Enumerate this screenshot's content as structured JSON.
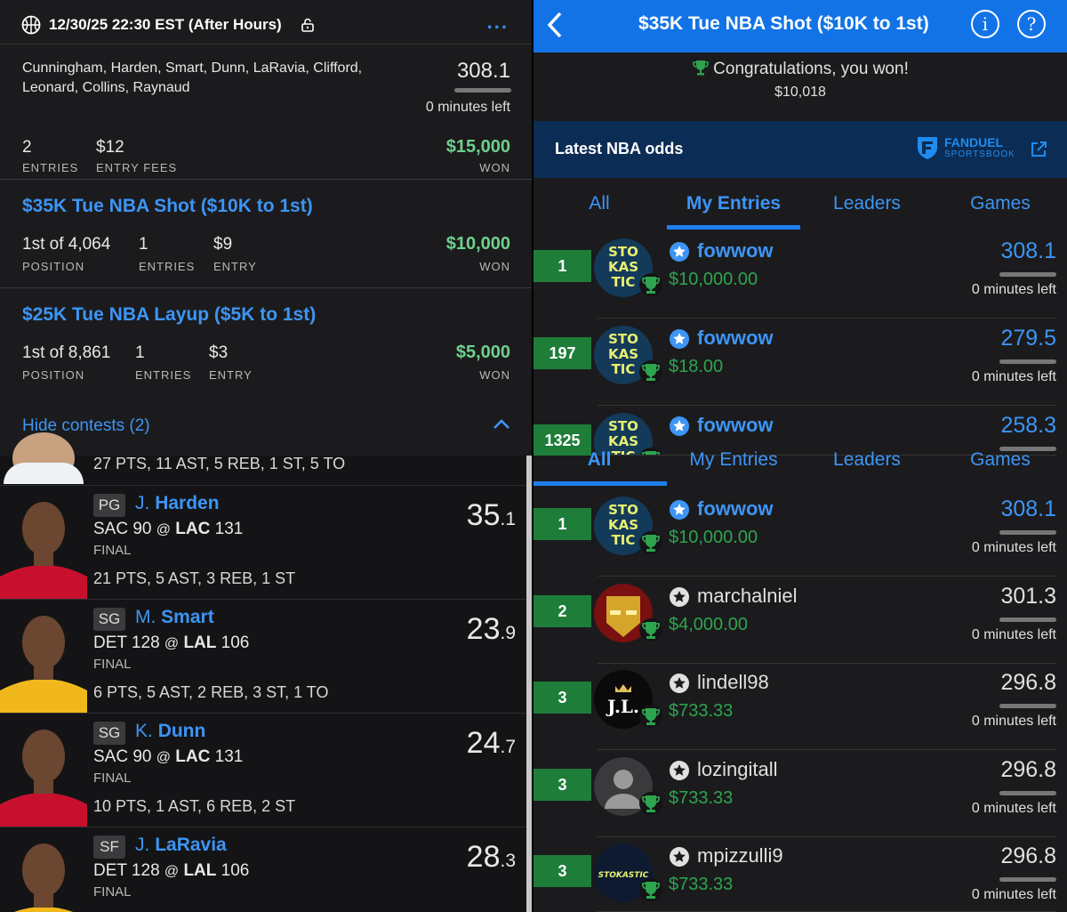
{
  "left": {
    "header": {
      "timestamp": "12/30/25 22:30 EST (After Hours)",
      "more": "..."
    },
    "lineup": {
      "players": "Cunningham, Harden, Smart, Dunn, LaRavia, Clifford, Leonard, Collins, Raynaud",
      "score": "308.1",
      "minutes_left": "0 minutes left",
      "entries_value": "2",
      "entries_label": "ENTRIES",
      "fees_value": "$12",
      "fees_label": "ENTRY FEES",
      "won_value": "$15,000",
      "won_label": "WON"
    },
    "contests": [
      {
        "title": "$35K Tue NBA Shot ($10K to 1st)",
        "position": "1st of 4,064",
        "position_label": "POSITION",
        "entries": "1",
        "entries_label": "ENTRIES",
        "entry": "$9",
        "entry_label": "ENTRY",
        "won": "$10,000",
        "won_label": "WON"
      },
      {
        "title": "$25K Tue NBA Layup ($5K to 1st)",
        "position": "1st of 8,861",
        "position_label": "POSITION",
        "entries": "1",
        "entries_label": "ENTRIES",
        "entry": "$3",
        "entry_label": "ENTRY",
        "won": "$5,000",
        "won_label": "WON"
      }
    ],
    "hide_contests": "Hide contests (2)",
    "top_partial_stats": "27 PTS, 11 AST, 5 REB, 1 ST, 5 TO",
    "players": [
      {
        "pos": "PG",
        "initial": "J.",
        "last": "Harden",
        "game_away": "SAC 90",
        "at": "@",
        "game_home": "LAC",
        "home_score": "131",
        "status": "FINAL",
        "line": "21 PTS, 5 AST, 3 REB, 1 ST",
        "score_int": "35",
        "score_dec": ".1",
        "jersey": "#c8102e"
      },
      {
        "pos": "SG",
        "initial": "M.",
        "last": "Smart",
        "game_away": "DET 128",
        "at": "@",
        "game_home": "LAL",
        "home_score": "106",
        "status": "FINAL",
        "line": "6 PTS, 5 AST, 2 REB, 3 ST, 1 TO",
        "score_int": "23",
        "score_dec": ".9",
        "jersey": "#f0b81c"
      },
      {
        "pos": "SG",
        "initial": "K.",
        "last": "Dunn",
        "game_away": "SAC 90",
        "at": "@",
        "game_home": "LAC",
        "home_score": "131",
        "status": "FINAL",
        "line": "10 PTS, 1 AST, 6 REB, 2 ST",
        "score_int": "24",
        "score_dec": ".7",
        "jersey": "#c8102e"
      },
      {
        "pos": "SF",
        "initial": "J.",
        "last": "LaRavia",
        "game_away": "DET 128",
        "at": "@",
        "game_home": "LAL",
        "home_score": "106",
        "status": "FINAL",
        "line": "",
        "score_int": "28",
        "score_dec": ".3",
        "jersey": "#f0b81c"
      }
    ]
  },
  "right": {
    "header": {
      "title": "$35K Tue NBA Shot ($10K to 1st)",
      "info": "i",
      "help": "?"
    },
    "congrats": "Congratulations, you won!",
    "prize": "$10,018",
    "odds": {
      "title": "Latest NBA odds",
      "brand": "FANDUEL",
      "brand_sub": "SPORTSBOOK"
    },
    "tabs": [
      "All",
      "My Entries",
      "Leaders",
      "Games"
    ],
    "my_entries": [
      {
        "rank": "1",
        "user": "fowwow",
        "prize": "$10,000.00",
        "score": "308.1",
        "mins": "0 minutes left"
      },
      {
        "rank": "197",
        "user": "fowwow",
        "prize": "$18.00",
        "score": "279.5",
        "mins": "0 minutes left"
      },
      {
        "rank": "1325",
        "user": "fowwow",
        "prize": "",
        "score": "258.3",
        "mins": ""
      }
    ],
    "leaders": [
      {
        "rank": "1",
        "user": "fowwow",
        "prize": "$10,000.00",
        "score": "308.1",
        "mins": "0 minutes left",
        "avatar": "stokastic"
      },
      {
        "rank": "2",
        "user": "marchalniel",
        "prize": "$4,000.00",
        "score": "301.3",
        "mins": "0 minutes left",
        "avatar": "ironman"
      },
      {
        "rank": "3",
        "user": "lindell98",
        "prize": "$733.33",
        "score": "296.8",
        "mins": "0 minutes left",
        "avatar": "jl"
      },
      {
        "rank": "3",
        "user": "lozingitall",
        "prize": "$733.33",
        "score": "296.8",
        "mins": "0 minutes left",
        "avatar": "default"
      },
      {
        "rank": "3",
        "user": "mpizzulli9",
        "prize": "$733.33",
        "score": "296.8",
        "mins": "0 minutes left",
        "avatar": "stokastic-wide"
      }
    ],
    "stokastic_text": [
      "STO",
      "KAS",
      "TIC"
    ],
    "stokastic_wide": "STOKASTIC",
    "jl_text": "J.L."
  },
  "colors": {
    "accent": "#3d95f5",
    "won_green": "#6ed08c",
    "rank_green": "#1f7d3a",
    "header_blue": "#1273e6",
    "odds_navy": "#0b2c54"
  }
}
